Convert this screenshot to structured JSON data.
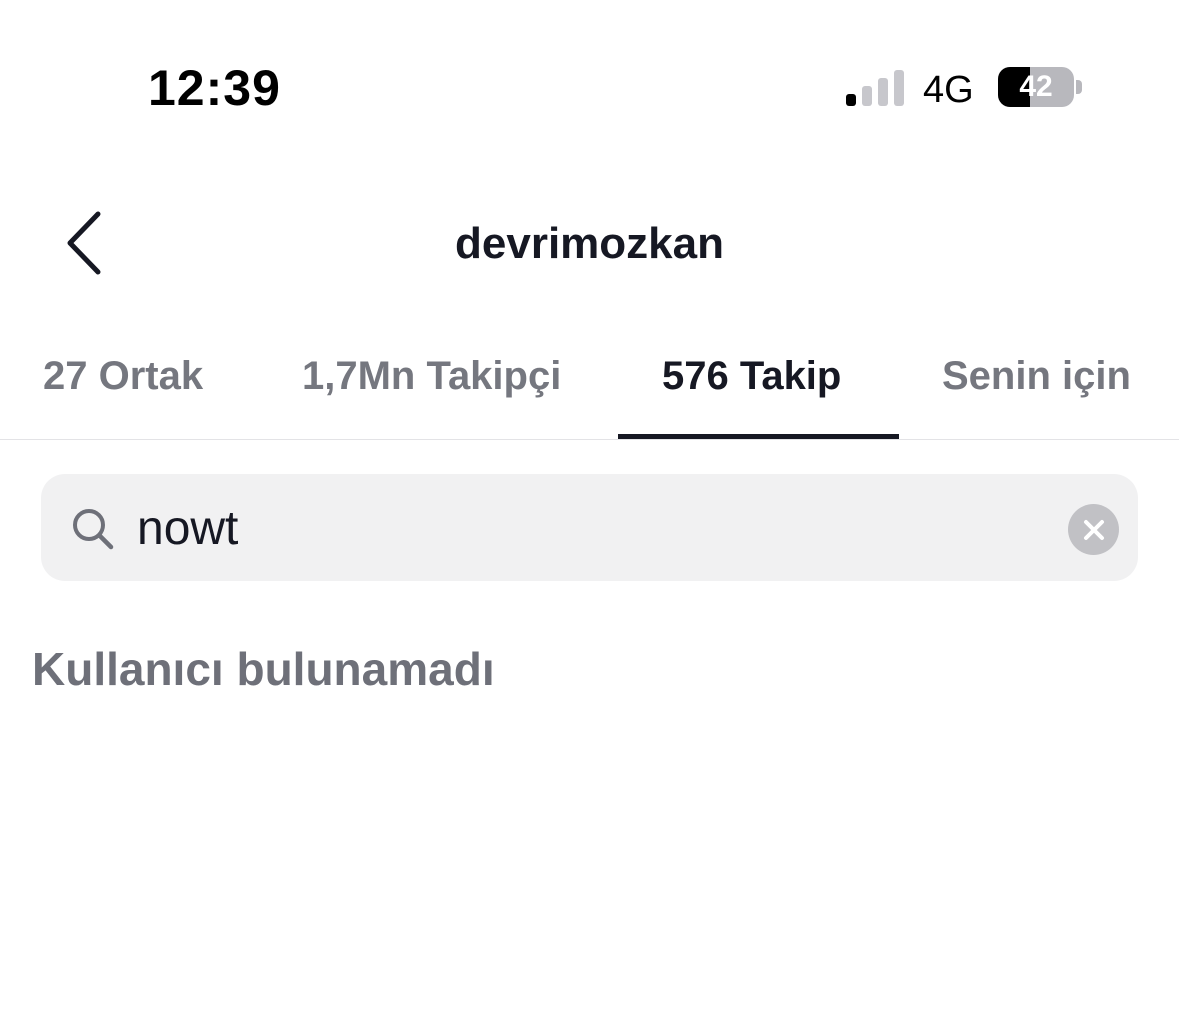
{
  "status_bar": {
    "time": "12:39",
    "network": "4G",
    "battery": "42",
    "battery_level": 0.42
  },
  "header": {
    "title": "devrimozkan",
    "back_icon": "chevron-left-icon"
  },
  "tabs": [
    {
      "label": "27 Ortak",
      "active": false
    },
    {
      "label": "1,7Mn Takipçi",
      "active": false
    },
    {
      "label": "576 Takip",
      "active": true
    },
    {
      "label": "Senin için",
      "active": false
    }
  ],
  "search": {
    "value": "nowt",
    "icon": "search-icon",
    "clear_icon": "clear-icon"
  },
  "results": {
    "empty_message": "Kullanıcı bulunamadı"
  },
  "colors": {
    "primary_text": "#161823",
    "inactive_tab": "#75777f",
    "search_bg": "#f1f1f2",
    "empty_text": "#6e7079"
  }
}
